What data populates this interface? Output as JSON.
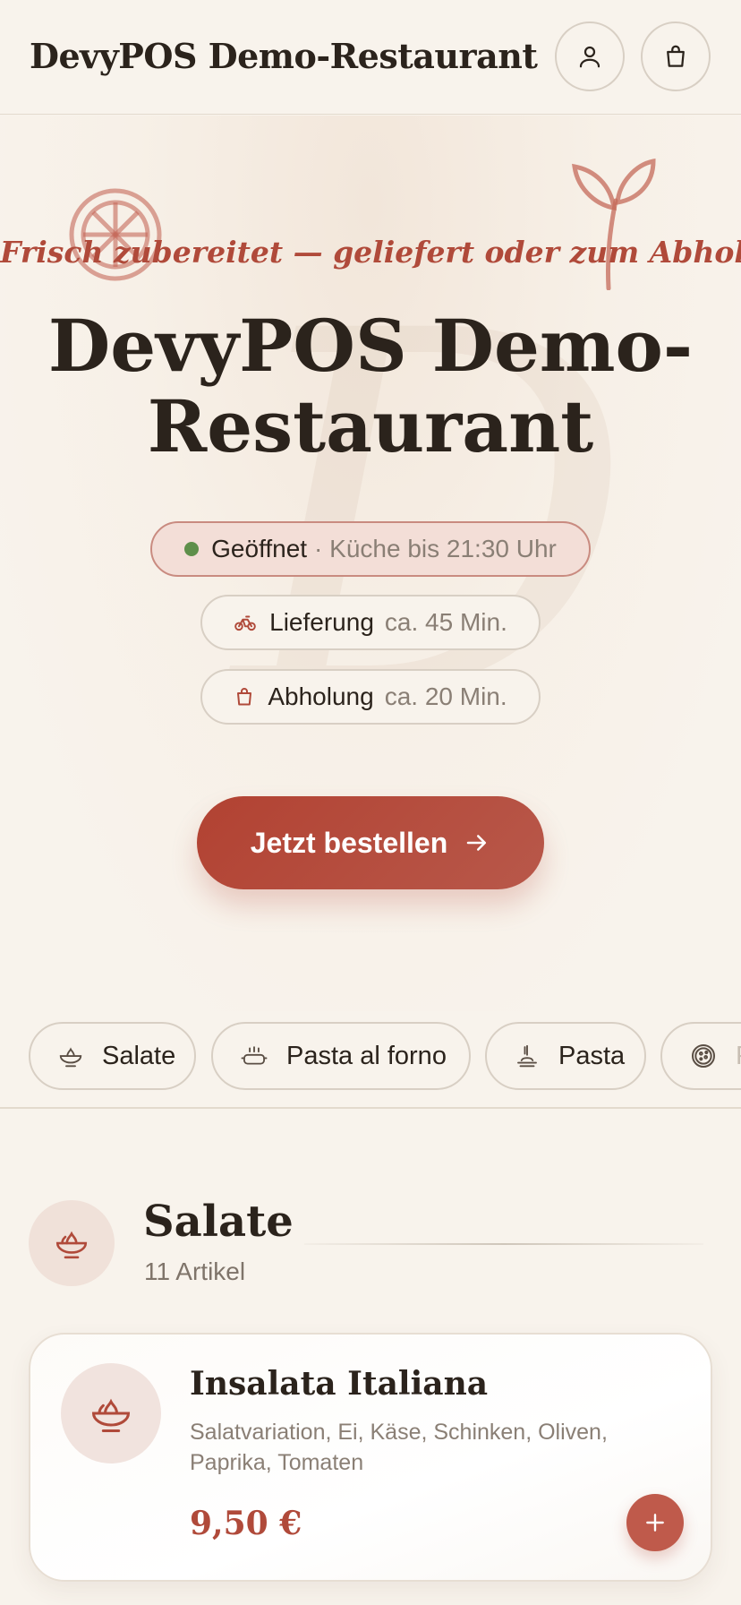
{
  "header": {
    "brand": "DevyPOS Demo-Restaurant",
    "account_icon": "user-icon",
    "cart_icon": "shopping-bag-icon"
  },
  "hero": {
    "tagline": "Frisch zubereitet — geliefert oder zum Abholen.",
    "title": "DevyPOS Demo-Restaurant",
    "status": {
      "label": "Geöffnet",
      "detail": "· Küche bis 21:30 Uhr",
      "color": "#5e8f4a"
    },
    "delivery": {
      "label": "Lieferung",
      "time": "ca. 45 Min.",
      "icon": "bicycle-icon"
    },
    "pickup": {
      "label": "Abholung",
      "time": "ca. 20 Min.",
      "icon": "bag-icon"
    },
    "cta_label": "Jetzt bestellen"
  },
  "categories": [
    {
      "label": "Salate",
      "icon": "salad-bowl-icon"
    },
    {
      "label": "Pasta al forno",
      "icon": "baking-dish-icon"
    },
    {
      "label": "Pasta",
      "icon": "pasta-plate-icon"
    },
    {
      "label": "P",
      "icon": "pizza-icon"
    }
  ],
  "section": {
    "title": "Salate",
    "count": "11 Artikel"
  },
  "products": [
    {
      "name": "Insalata Italiana",
      "description": "Salatvariation, Ei, Käse, Schinken, Oliven, Paprika, Tomaten",
      "price": "9,50 €"
    }
  ],
  "colors": {
    "accent": "#b04a3a",
    "background": "#f8f3ec",
    "open_status": "#5e8f4a"
  }
}
